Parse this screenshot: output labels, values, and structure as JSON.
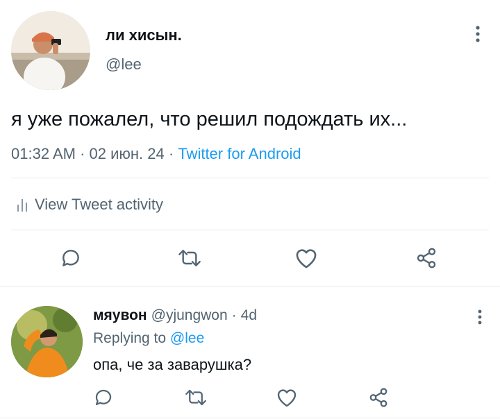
{
  "tweet": {
    "author_name": "ли хисын.",
    "author_handle": "@lee",
    "text": "я уже пожалел, что решил подождать их...",
    "time": "01:32 AM",
    "date": "02 июн. 24",
    "separator": "·",
    "source": "Twitter for Android",
    "activity_label": "View Tweet activity",
    "actions": [
      "reply-icon",
      "retweet-icon",
      "like-icon",
      "share-icon"
    ]
  },
  "reply": {
    "author_name": "мяувон",
    "author_handle": "@yjungwon",
    "age": "4d",
    "replying_to_label": "Replying to",
    "replying_to_handle": "@lee",
    "text": "опа, че за заварушка?",
    "actions": [
      "reply-icon",
      "retweet-icon",
      "like-icon",
      "share-icon"
    ]
  },
  "colors": {
    "accent": "#1d9bf0",
    "secondary_text": "#536471",
    "primary_text": "#0f1419",
    "divider": "#e6e9ec"
  }
}
